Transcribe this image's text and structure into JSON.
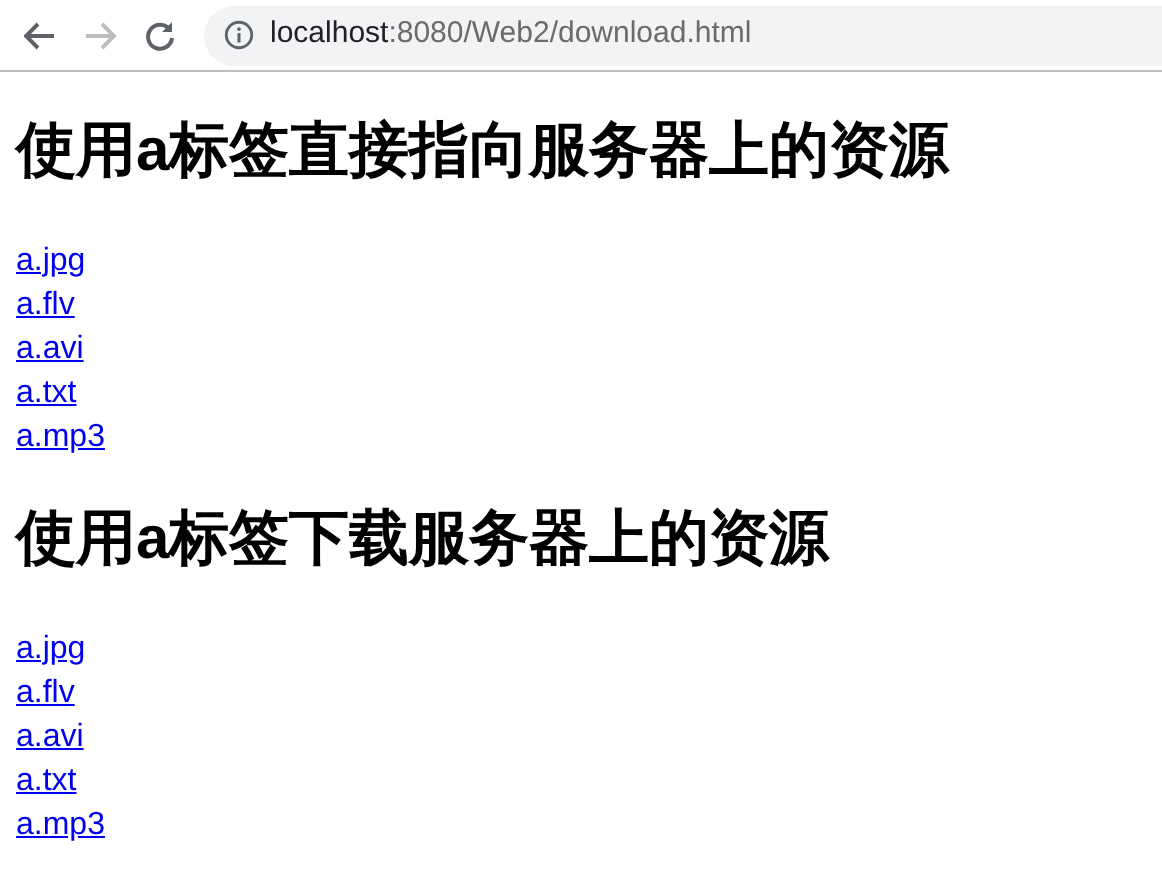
{
  "toolbar": {
    "back": {
      "disabled": false
    },
    "forward": {
      "disabled": true
    },
    "address": {
      "host": "localhost",
      "path": ":8080/Web2/download.html"
    }
  },
  "sections": [
    {
      "heading": "使用a标签直接指向服务器上的资源",
      "links": [
        "a.jpg",
        "a.flv",
        "a.avi",
        "a.txt",
        "a.mp3"
      ]
    },
    {
      "heading": "使用a标签下载服务器上的资源",
      "links": [
        "a.jpg",
        "a.flv",
        "a.avi",
        "a.txt",
        "a.mp3"
      ]
    }
  ]
}
